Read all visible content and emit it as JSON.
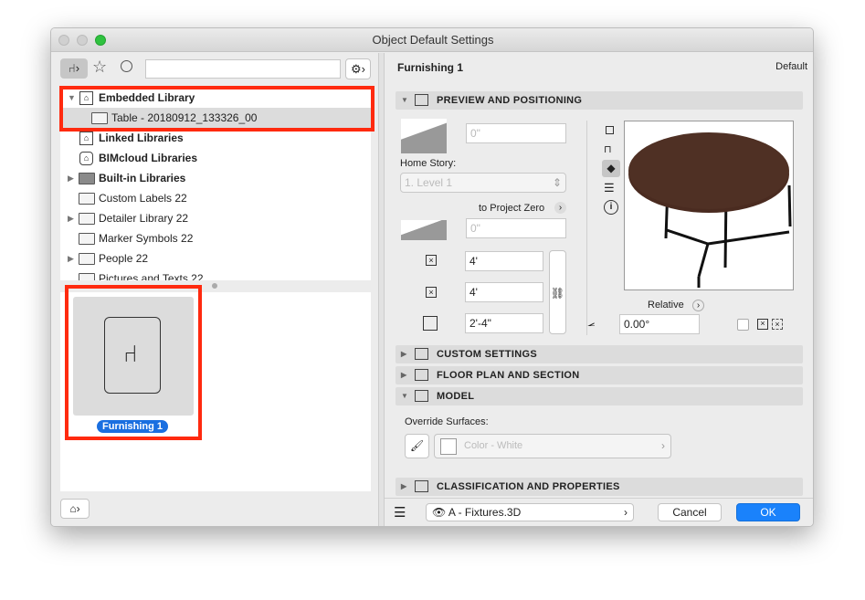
{
  "window": {
    "title": "Object Default Settings"
  },
  "left": {
    "search": {
      "value": "",
      "placeholder": ""
    },
    "tree": [
      {
        "label": "Embedded Library",
        "bold": true,
        "expanded": true,
        "icon": "library-icon"
      },
      {
        "label": "Table - 20180912_133326_00",
        "bold": false,
        "icon": "folder-icon",
        "selected": true
      },
      {
        "label": "Linked Libraries",
        "bold": true,
        "icon": "library-icon"
      },
      {
        "label": "BIMcloud Libraries",
        "bold": true,
        "icon": "bimcloud-icon"
      },
      {
        "label": "Built-in Libraries",
        "bold": true,
        "collapsed": true,
        "icon": "folder-dark-icon"
      },
      {
        "label": "Custom Labels 22",
        "icon": "folder-icon"
      },
      {
        "label": "Detailer Library 22",
        "collapsed": true,
        "icon": "folder-icon"
      },
      {
        "label": "Marker Symbols 22",
        "icon": "folder-icon"
      },
      {
        "label": "People 22",
        "collapsed": true,
        "icon": "folder-icon"
      },
      {
        "label": "Pictures and Texts 22",
        "icon": "folder-icon"
      }
    ],
    "preview_item": {
      "label": "Furnishing 1"
    },
    "highlight_color": "#ff2a0f"
  },
  "right": {
    "object_name": "Furnishing 1",
    "default_label": "Default",
    "sections": {
      "preview": "PREVIEW AND POSITIONING",
      "custom": "CUSTOM SETTINGS",
      "floorplan": "FLOOR PLAN AND SECTION",
      "model": "MODEL",
      "classification": "CLASSIFICATION AND PROPERTIES"
    },
    "elevation": "0\"",
    "home_story_label": "Home Story:",
    "home_story_value": "1. Level 1",
    "to_project_zero": "to Project Zero",
    "project_zero_value": "0\"",
    "width": "4'",
    "depth": "4'",
    "height": "2'-4\"",
    "relative_label": "Relative",
    "angle": "0.00°",
    "override_surfaces_label": "Override Surfaces:",
    "surface_value": "Color - White",
    "layer_value": "A - Fixtures.3D",
    "cancel": "Cancel",
    "ok": "OK",
    "accent": "#1a82fb"
  }
}
